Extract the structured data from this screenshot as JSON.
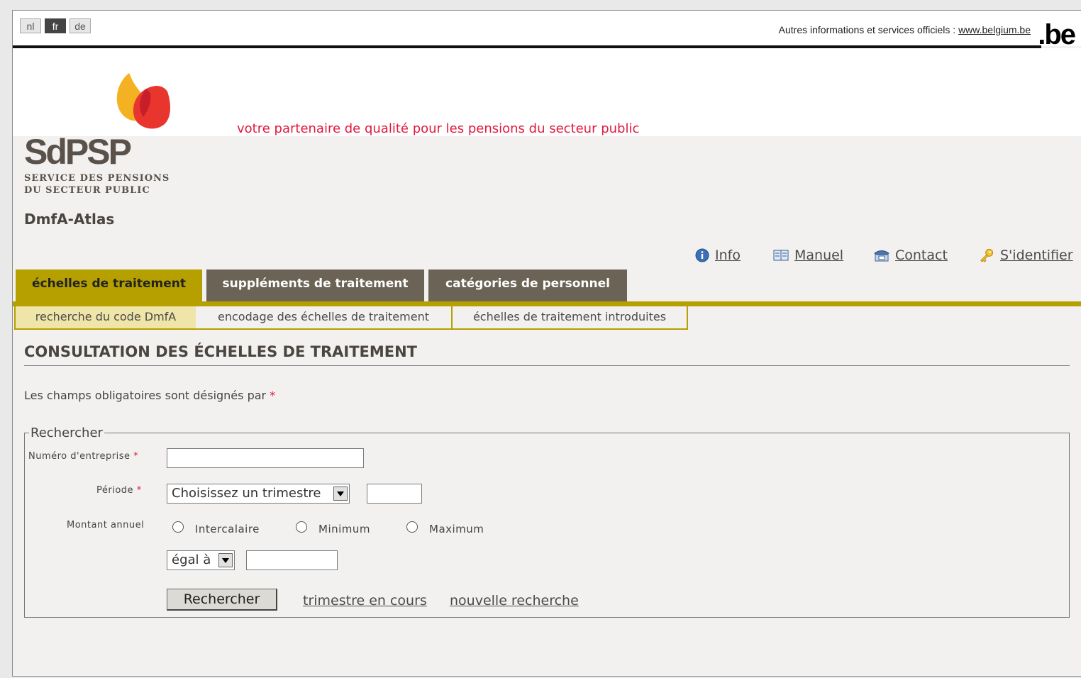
{
  "languages": [
    {
      "label": "nl",
      "active": false
    },
    {
      "label": "fr",
      "active": true
    },
    {
      "label": "de",
      "active": false
    }
  ],
  "official": {
    "text": "Autres informations et services officiels :",
    "link": "www.belgium.be",
    "be_logo": ".be"
  },
  "brand": {
    "logo_text": "SdPSP",
    "logo_sub_line1": "SERVICE DES PENSIONS",
    "logo_sub_line2": "DU SECTEUR PUBLIC",
    "tagline": "votre partenaire de qualité pour les pensions du secteur public",
    "app_name": "DmfA-Atlas",
    "colors": {
      "tagline": "#e0193d",
      "tab_active": "#b5a000",
      "tab_inactive": "#6b6355"
    }
  },
  "util_links": [
    {
      "label": "Info",
      "icon": "info-icon"
    },
    {
      "label": "Manuel",
      "icon": "book-icon"
    },
    {
      "label": "Contact",
      "icon": "phone-icon"
    },
    {
      "label": "S'identifier",
      "icon": "key-icon"
    }
  ],
  "tabs": [
    {
      "label": "échelles de traitement",
      "active": true
    },
    {
      "label": "suppléments de traitement",
      "active": false
    },
    {
      "label": "catégories de personnel",
      "active": false
    }
  ],
  "subtabs": [
    {
      "label": "recherche du code DmfA",
      "active": true
    },
    {
      "label": "encodage des échelles de traitement",
      "active": false
    },
    {
      "label": "échelles de traitement introduites",
      "active": false
    }
  ],
  "page": {
    "title": "CONSULTATION DES ÉCHELLES DE TRAITEMENT",
    "required_note": "Les champs obligatoires sont désignés par",
    "required_mark": "*"
  },
  "search": {
    "legend": "Rechercher",
    "enterprise_label": "Numéro d'entreprise",
    "enterprise_value": "",
    "period_label": "Période",
    "period_select": "Choisissez un trimestre",
    "period_year": "",
    "amount_label": "Montant annuel",
    "radio_options": [
      "Intercalaire",
      "Minimum",
      "Maximum"
    ],
    "comparator": "égal à",
    "amount_value": "",
    "submit_label": "Rechercher",
    "link_current": "trimestre en cours",
    "link_new": "nouvelle recherche"
  }
}
